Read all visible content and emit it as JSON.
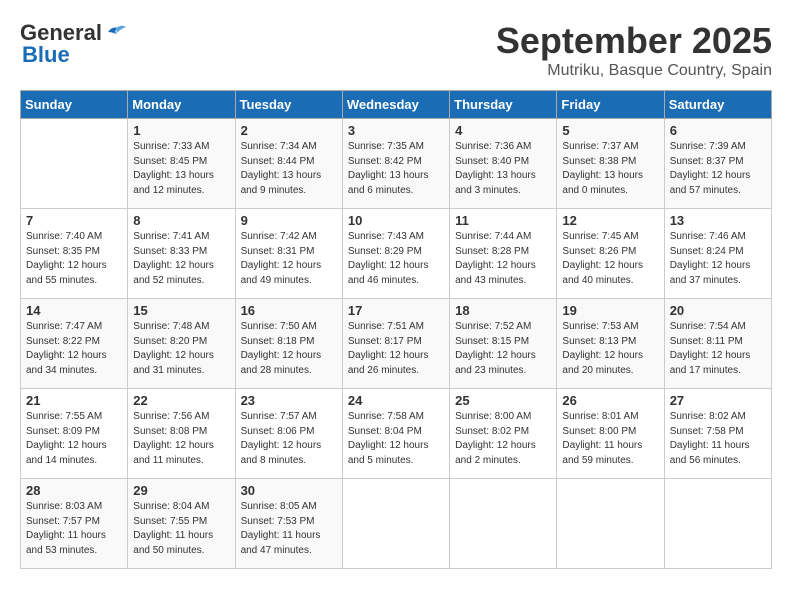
{
  "logo": {
    "part1": "General",
    "part2": "Blue"
  },
  "title": "September 2025",
  "location": "Mutriku, Basque Country, Spain",
  "days_header": [
    "Sunday",
    "Monday",
    "Tuesday",
    "Wednesday",
    "Thursday",
    "Friday",
    "Saturday"
  ],
  "weeks": [
    [
      {
        "num": "",
        "info": ""
      },
      {
        "num": "1",
        "info": "Sunrise: 7:33 AM\nSunset: 8:45 PM\nDaylight: 13 hours\nand 12 minutes."
      },
      {
        "num": "2",
        "info": "Sunrise: 7:34 AM\nSunset: 8:44 PM\nDaylight: 13 hours\nand 9 minutes."
      },
      {
        "num": "3",
        "info": "Sunrise: 7:35 AM\nSunset: 8:42 PM\nDaylight: 13 hours\nand 6 minutes."
      },
      {
        "num": "4",
        "info": "Sunrise: 7:36 AM\nSunset: 8:40 PM\nDaylight: 13 hours\nand 3 minutes."
      },
      {
        "num": "5",
        "info": "Sunrise: 7:37 AM\nSunset: 8:38 PM\nDaylight: 13 hours\nand 0 minutes."
      },
      {
        "num": "6",
        "info": "Sunrise: 7:39 AM\nSunset: 8:37 PM\nDaylight: 12 hours\nand 57 minutes."
      }
    ],
    [
      {
        "num": "7",
        "info": "Sunrise: 7:40 AM\nSunset: 8:35 PM\nDaylight: 12 hours\nand 55 minutes."
      },
      {
        "num": "8",
        "info": "Sunrise: 7:41 AM\nSunset: 8:33 PM\nDaylight: 12 hours\nand 52 minutes."
      },
      {
        "num": "9",
        "info": "Sunrise: 7:42 AM\nSunset: 8:31 PM\nDaylight: 12 hours\nand 49 minutes."
      },
      {
        "num": "10",
        "info": "Sunrise: 7:43 AM\nSunset: 8:29 PM\nDaylight: 12 hours\nand 46 minutes."
      },
      {
        "num": "11",
        "info": "Sunrise: 7:44 AM\nSunset: 8:28 PM\nDaylight: 12 hours\nand 43 minutes."
      },
      {
        "num": "12",
        "info": "Sunrise: 7:45 AM\nSunset: 8:26 PM\nDaylight: 12 hours\nand 40 minutes."
      },
      {
        "num": "13",
        "info": "Sunrise: 7:46 AM\nSunset: 8:24 PM\nDaylight: 12 hours\nand 37 minutes."
      }
    ],
    [
      {
        "num": "14",
        "info": "Sunrise: 7:47 AM\nSunset: 8:22 PM\nDaylight: 12 hours\nand 34 minutes."
      },
      {
        "num": "15",
        "info": "Sunrise: 7:48 AM\nSunset: 8:20 PM\nDaylight: 12 hours\nand 31 minutes."
      },
      {
        "num": "16",
        "info": "Sunrise: 7:50 AM\nSunset: 8:18 PM\nDaylight: 12 hours\nand 28 minutes."
      },
      {
        "num": "17",
        "info": "Sunrise: 7:51 AM\nSunset: 8:17 PM\nDaylight: 12 hours\nand 26 minutes."
      },
      {
        "num": "18",
        "info": "Sunrise: 7:52 AM\nSunset: 8:15 PM\nDaylight: 12 hours\nand 23 minutes."
      },
      {
        "num": "19",
        "info": "Sunrise: 7:53 AM\nSunset: 8:13 PM\nDaylight: 12 hours\nand 20 minutes."
      },
      {
        "num": "20",
        "info": "Sunrise: 7:54 AM\nSunset: 8:11 PM\nDaylight: 12 hours\nand 17 minutes."
      }
    ],
    [
      {
        "num": "21",
        "info": "Sunrise: 7:55 AM\nSunset: 8:09 PM\nDaylight: 12 hours\nand 14 minutes."
      },
      {
        "num": "22",
        "info": "Sunrise: 7:56 AM\nSunset: 8:08 PM\nDaylight: 12 hours\nand 11 minutes."
      },
      {
        "num": "23",
        "info": "Sunrise: 7:57 AM\nSunset: 8:06 PM\nDaylight: 12 hours\nand 8 minutes."
      },
      {
        "num": "24",
        "info": "Sunrise: 7:58 AM\nSunset: 8:04 PM\nDaylight: 12 hours\nand 5 minutes."
      },
      {
        "num": "25",
        "info": "Sunrise: 8:00 AM\nSunset: 8:02 PM\nDaylight: 12 hours\nand 2 minutes."
      },
      {
        "num": "26",
        "info": "Sunrise: 8:01 AM\nSunset: 8:00 PM\nDaylight: 11 hours\nand 59 minutes."
      },
      {
        "num": "27",
        "info": "Sunrise: 8:02 AM\nSunset: 7:58 PM\nDaylight: 11 hours\nand 56 minutes."
      }
    ],
    [
      {
        "num": "28",
        "info": "Sunrise: 8:03 AM\nSunset: 7:57 PM\nDaylight: 11 hours\nand 53 minutes."
      },
      {
        "num": "29",
        "info": "Sunrise: 8:04 AM\nSunset: 7:55 PM\nDaylight: 11 hours\nand 50 minutes."
      },
      {
        "num": "30",
        "info": "Sunrise: 8:05 AM\nSunset: 7:53 PM\nDaylight: 11 hours\nand 47 minutes."
      },
      {
        "num": "",
        "info": ""
      },
      {
        "num": "",
        "info": ""
      },
      {
        "num": "",
        "info": ""
      },
      {
        "num": "",
        "info": ""
      }
    ]
  ]
}
